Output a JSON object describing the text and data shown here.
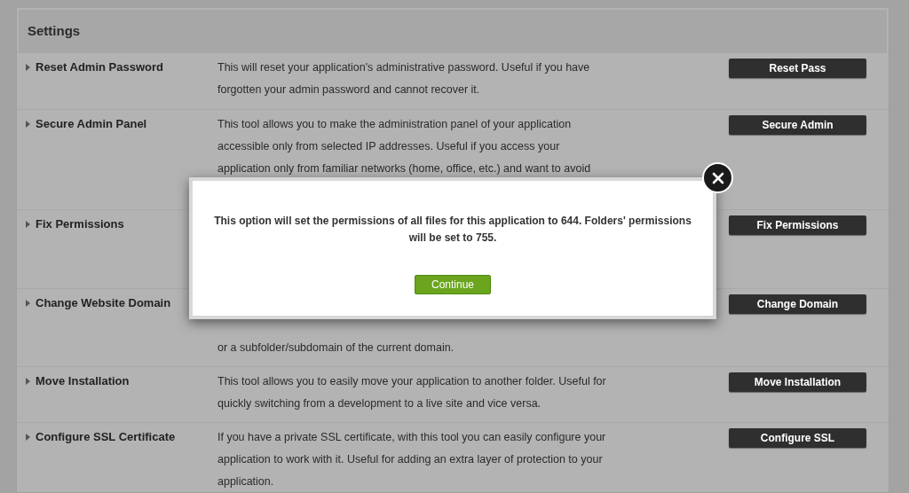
{
  "panel": {
    "title": "Settings"
  },
  "rows": [
    {
      "label": "Reset Admin Password",
      "lines": [
        "This will reset your application's administrative password. Useful if you have",
        "forgotten your admin password and cannot recover it."
      ],
      "button": "Reset Pass"
    },
    {
      "label": "Secure Admin Panel",
      "lines": [
        "This tool allows you to make the administration panel of your application",
        "accessible only from selected IP addresses. Useful if you access your",
        "application only from familiar networks (home, office, etc.) and want to avoid"
      ],
      "button": "Secure Admin"
    },
    {
      "label": "Fix Permissions",
      "lines": [],
      "button": "Fix Permissions"
    },
    {
      "label": "Change Website Domain",
      "lines": [
        "or a subfolder/subdomain of the current domain."
      ],
      "button": "Change Domain"
    },
    {
      "label": "Move Installation",
      "lines": [
        "This tool allows you to easily move your application to another folder. Useful for",
        "quickly switching from a development to a live site and vice versa."
      ],
      "button": "Move Installation"
    },
    {
      "label": "Configure SSL Certificate",
      "lines": [
        "If you have a private SSL certificate, with this tool you can easily configure your",
        "application to work with it. Useful for adding an extra layer of protection to your",
        "application."
      ],
      "button": "Configure SSL"
    }
  ],
  "dialog": {
    "message": "This option will set the permissions of all files for this application to 644. Folders' permissions will be set to 755.",
    "button": "Continue"
  }
}
